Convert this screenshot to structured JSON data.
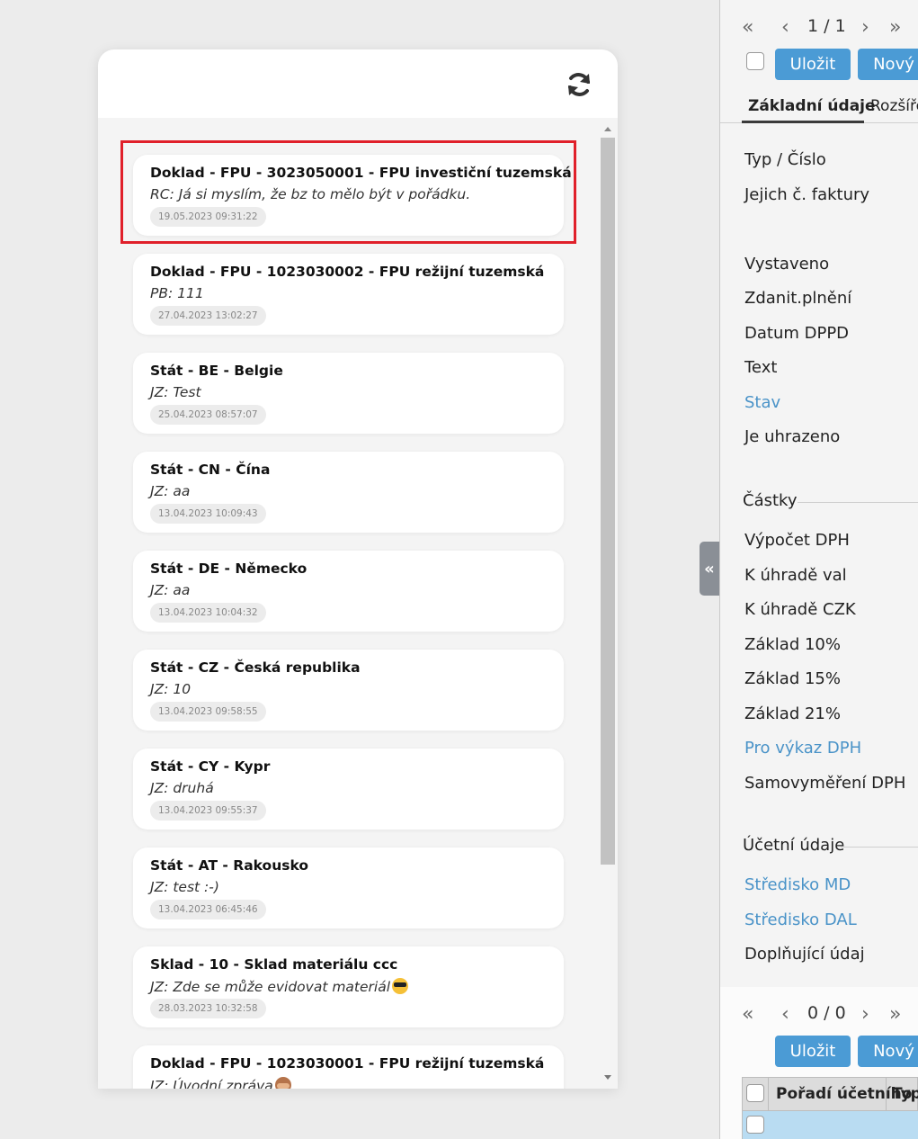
{
  "notifications": [
    {
      "title": "Doklad - FPU - 3023050001 - FPU investiční tuzemská",
      "message": "RC: Já si myslím, že bz to mělo být v pořádku.",
      "time": "19.05.2023 09:31:22"
    },
    {
      "title": "Doklad - FPU - 1023030002 - FPU režijní tuzemská",
      "message": "PB: 111",
      "time": "27.04.2023 13:02:27"
    },
    {
      "title": "Stát - BE - Belgie",
      "message": "JZ: Test",
      "time": "25.04.2023 08:57:07"
    },
    {
      "title": "Stát - CN - Čína",
      "message": "JZ: aa",
      "time": "13.04.2023 10:09:43"
    },
    {
      "title": "Stát - DE - Německo",
      "message": "JZ: aa",
      "time": "13.04.2023 10:04:32"
    },
    {
      "title": "Stát - CZ - Česká republika",
      "message": "JZ: 10",
      "time": "13.04.2023 09:58:55"
    },
    {
      "title": "Stát - CY - Kypr",
      "message": "JZ: druhá",
      "time": "13.04.2023 09:55:37"
    },
    {
      "title": "Stát - AT - Rakousko",
      "message": "JZ: test :-)",
      "time": "13.04.2023 06:45:46"
    },
    {
      "title": "Sklad - 10 - Sklad materiálu ccc",
      "message": "JZ: Zde se může evidovat materiál",
      "time": "28.03.2023 10:32:58",
      "emoji": "sunglasses-emoji"
    },
    {
      "title": "Doklad - FPU - 1023030001 - FPU režijní tuzemská",
      "message": "JZ: Úvodní zpráva",
      "time": "",
      "emoji": "monkey-emoji"
    }
  ],
  "highlight_color": "#e0202a",
  "right": {
    "nav_top": {
      "count": "1 / 1"
    },
    "buttons_top": {
      "save": "Uložit",
      "new": "Nový"
    },
    "tabs": {
      "basic": "Základní údaje",
      "extended": "Rozšíře"
    },
    "fields_group1": [
      "Typ / Číslo",
      "Jejich č. faktury"
    ],
    "fields_group2": [
      {
        "label": "Vystaveno",
        "link": false
      },
      {
        "label": "Zdanit.plnění",
        "link": false
      },
      {
        "label": "Datum DPPD",
        "link": false
      },
      {
        "label": "Text",
        "link": false
      },
      {
        "label": "Stav",
        "link": true
      },
      {
        "label": "Je uhrazeno",
        "link": false
      }
    ],
    "section_amounts": "Částky",
    "fields_amounts": [
      {
        "label": "Výpočet DPH",
        "link": false
      },
      {
        "label": "K úhradě val",
        "link": false
      },
      {
        "label": "K úhradě CZK",
        "link": false
      },
      {
        "label": "Základ 10%",
        "link": false
      },
      {
        "label": "Základ 15%",
        "link": false
      },
      {
        "label": "Základ 21%",
        "link": false
      },
      {
        "label": "Pro výkaz DPH",
        "link": true
      },
      {
        "label": "Samovyměření DPH",
        "link": false
      }
    ],
    "section_accounting": "Účetní údaje",
    "fields_accounting": [
      {
        "label": "Středisko MD",
        "link": true
      },
      {
        "label": "Středisko DAL",
        "link": true
      },
      {
        "label": "Doplňující údaj",
        "link": false
      }
    ],
    "nav_bottom": {
      "count": "0 / 0"
    },
    "buttons_bottom": {
      "save": "Uložit",
      "new": "Nový"
    },
    "grid_columns": [
      "Pořadí účetního",
      "Typ"
    ],
    "link_color": "#4a93c8",
    "button_color": "#4b9bd5"
  }
}
